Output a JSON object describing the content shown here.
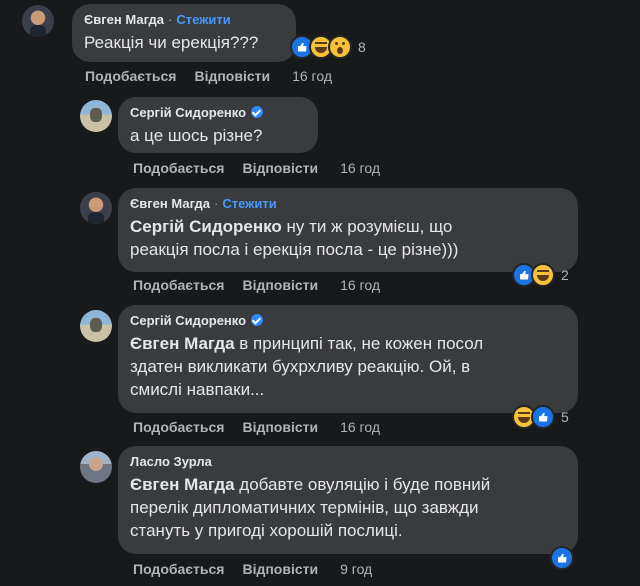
{
  "comments": [
    {
      "author": "Євген Магда",
      "follow": "Стежити",
      "text": "Реакція чи ерекція???",
      "like": "Подобається",
      "reply": "Відповісти",
      "time": "16 год",
      "reactions": {
        "icons": [
          "like-icon",
          "haha-icon",
          "wow-icon"
        ],
        "count": "8"
      }
    },
    {
      "author": "Сергій Сидоренко",
      "text": "а це шось різне?",
      "like": "Подобається",
      "reply": "Відповісти",
      "time": "16 год"
    },
    {
      "author": "Євген Магда",
      "follow": "Стежити",
      "mention": "Сергій Сидоренко",
      "text1": " ну ти ж розумієш, що",
      "text2": "реакція посла і ерекція посла - це різне)))",
      "like": "Подобається",
      "reply": "Відповісти",
      "time": "16 год",
      "reactions": {
        "icons": [
          "like-icon",
          "haha-icon"
        ],
        "count": "2"
      }
    },
    {
      "author": "Сергій Сидоренко",
      "mention": "Євген Магда",
      "text1": " в принципі так, не кожен посол",
      "text2": "здатен викликати бухрхливу реакцію. Ой, в",
      "text3": "смислі навпаки...",
      "like": "Подобається",
      "reply": "Відповісти",
      "time": "16 год",
      "reactions": {
        "icons": [
          "haha-icon",
          "like-icon"
        ],
        "count": "5"
      }
    },
    {
      "author": "Ласло Зурла",
      "mention": "Євген Магда",
      "text1": " добавте овуляцію і буде повний",
      "text2": "перелік дипломатичних термінів, що завжди",
      "text3": "стануть у пригоді хорошій послиці.",
      "like": "Подобається",
      "reply": "Відповісти",
      "time": "9 год",
      "reactions": {
        "icons": [
          "like-icon"
        ]
      }
    }
  ]
}
